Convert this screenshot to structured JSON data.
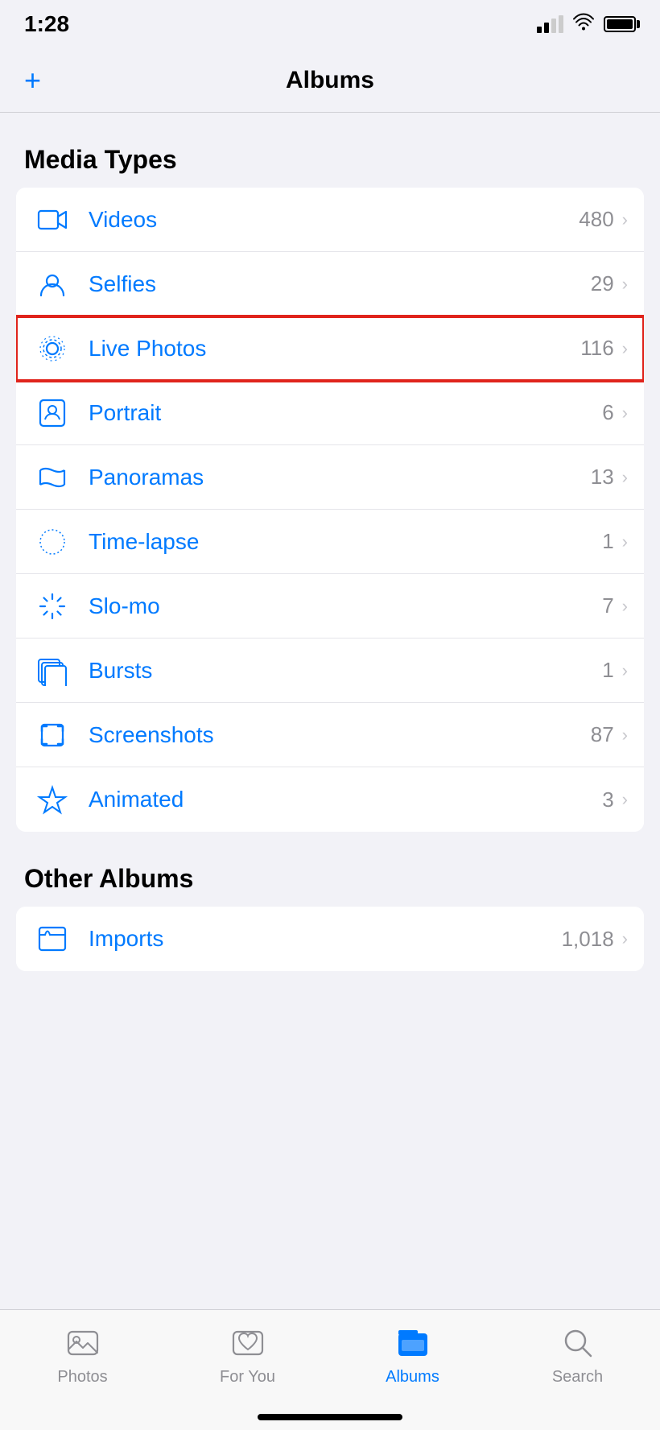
{
  "statusBar": {
    "time": "1:28",
    "location": true
  },
  "header": {
    "addButton": "+",
    "title": "Albums"
  },
  "mediaSectionTitle": "Media Types",
  "mediaItems": [
    {
      "id": "videos",
      "label": "Videos",
      "count": "480",
      "icon": "video"
    },
    {
      "id": "selfies",
      "label": "Selfies",
      "count": "29",
      "icon": "selfie"
    },
    {
      "id": "live-photos",
      "label": "Live Photos",
      "count": "116",
      "icon": "live",
      "highlighted": true
    },
    {
      "id": "portrait",
      "label": "Portrait",
      "count": "6",
      "icon": "portrait"
    },
    {
      "id": "panoramas",
      "label": "Panoramas",
      "count": "13",
      "icon": "panorama"
    },
    {
      "id": "time-lapse",
      "label": "Time-lapse",
      "count": "1",
      "icon": "timelapse"
    },
    {
      "id": "slo-mo",
      "label": "Slo-mo",
      "count": "7",
      "icon": "slomo"
    },
    {
      "id": "bursts",
      "label": "Bursts",
      "count": "1",
      "icon": "bursts"
    },
    {
      "id": "screenshots",
      "label": "Screenshots",
      "count": "87",
      "icon": "screenshot"
    },
    {
      "id": "animated",
      "label": "Animated",
      "count": "3",
      "icon": "animated"
    }
  ],
  "otherSectionTitle": "Other Albums",
  "otherItems": [
    {
      "id": "imports",
      "label": "Imports",
      "count": "1,018",
      "icon": "imports"
    }
  ],
  "tabBar": {
    "items": [
      {
        "id": "photos",
        "label": "Photos",
        "active": false
      },
      {
        "id": "for-you",
        "label": "For You",
        "active": false
      },
      {
        "id": "albums",
        "label": "Albums",
        "active": true
      },
      {
        "id": "search",
        "label": "Search",
        "active": false
      }
    ]
  }
}
